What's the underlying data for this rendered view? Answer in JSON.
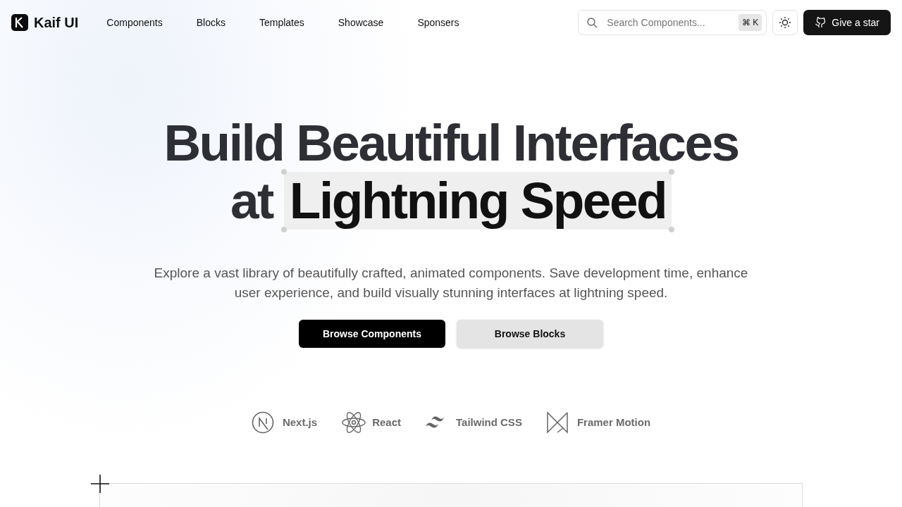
{
  "navbar": {
    "brand": "Kaif UI",
    "links": [
      "Components",
      "Blocks",
      "Templates",
      "Showcase",
      "Sponsers"
    ],
    "search": {
      "placeholder": "Search Components...",
      "shortcut": "⌘ K"
    },
    "star_button": "Give a star"
  },
  "hero": {
    "title_line_1": "Build Beautiful Interfaces",
    "title_line_2_prefix": "at",
    "title_highlight": "Lightning Speed",
    "subtitle": "Explore a vast library of beautifully crafted, animated components. Save development time, enhance user experience, and build visually stunning interfaces at lightning speed.",
    "buttons": [
      {
        "label": "Browse Components",
        "kind": "primary"
      },
      {
        "label": "Browse Blocks",
        "kind": "secondary"
      }
    ]
  },
  "technologies": [
    {
      "name": "Next.js",
      "kind": "nextjs"
    },
    {
      "name": "React",
      "kind": "react"
    },
    {
      "name": "Tailwind CSS",
      "kind": "tailwind"
    },
    {
      "name": "Framer Motion",
      "kind": "framer"
    }
  ]
}
